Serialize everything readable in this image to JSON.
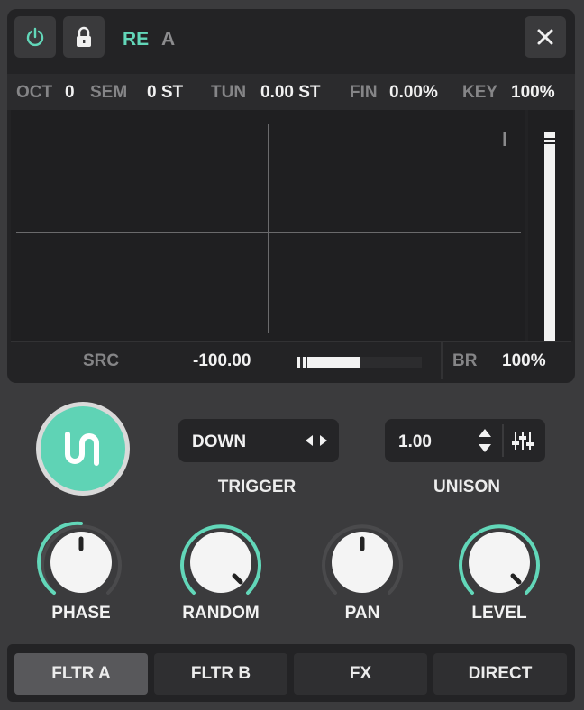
{
  "header": {
    "power_icon": "power-icon",
    "lock_icon": "lock-icon",
    "title_primary": "RE",
    "title_secondary": "A",
    "close_icon": "close-icon"
  },
  "tuning": {
    "oct_label": "OCT",
    "oct_value": "0",
    "sem_label": "SEM",
    "sem_value": "0 ST",
    "tun_label": "TUN",
    "tun_value": "0.00 ST",
    "fin_label": "FIN",
    "fin_value": "0.00%",
    "key_label": "KEY",
    "key_value": "100%"
  },
  "source": {
    "src_label": "SRC",
    "src_value": "-100.00",
    "src_bar_level": 0.5,
    "br_label": "BR",
    "br_value": "100%"
  },
  "unison_logo_icon": "unison-logo-icon",
  "trigger": {
    "value": "DOWN",
    "label": "TRIGGER",
    "arrows_icon": "left-right-arrows-icon"
  },
  "unison": {
    "value": "1.00",
    "label": "UNISON",
    "stepper_icon": "up-down-stepper-icon",
    "settings_icon": "sliders-icon"
  },
  "knobs": [
    {
      "label": "PHASE",
      "level": 0.5
    },
    {
      "label": "RANDOM",
      "level": 1.0
    },
    {
      "label": "PAN",
      "level": 0.5
    },
    {
      "label": "LEVEL",
      "level": 1.0
    }
  ],
  "tabs": [
    "FLTR A",
    "FLTR B",
    "FX",
    "DIRECT"
  ],
  "active_tab": "FLTR A",
  "colors": {
    "accent": "#62d7b9",
    "background": "#3b3b3d",
    "panel": "#232325"
  }
}
